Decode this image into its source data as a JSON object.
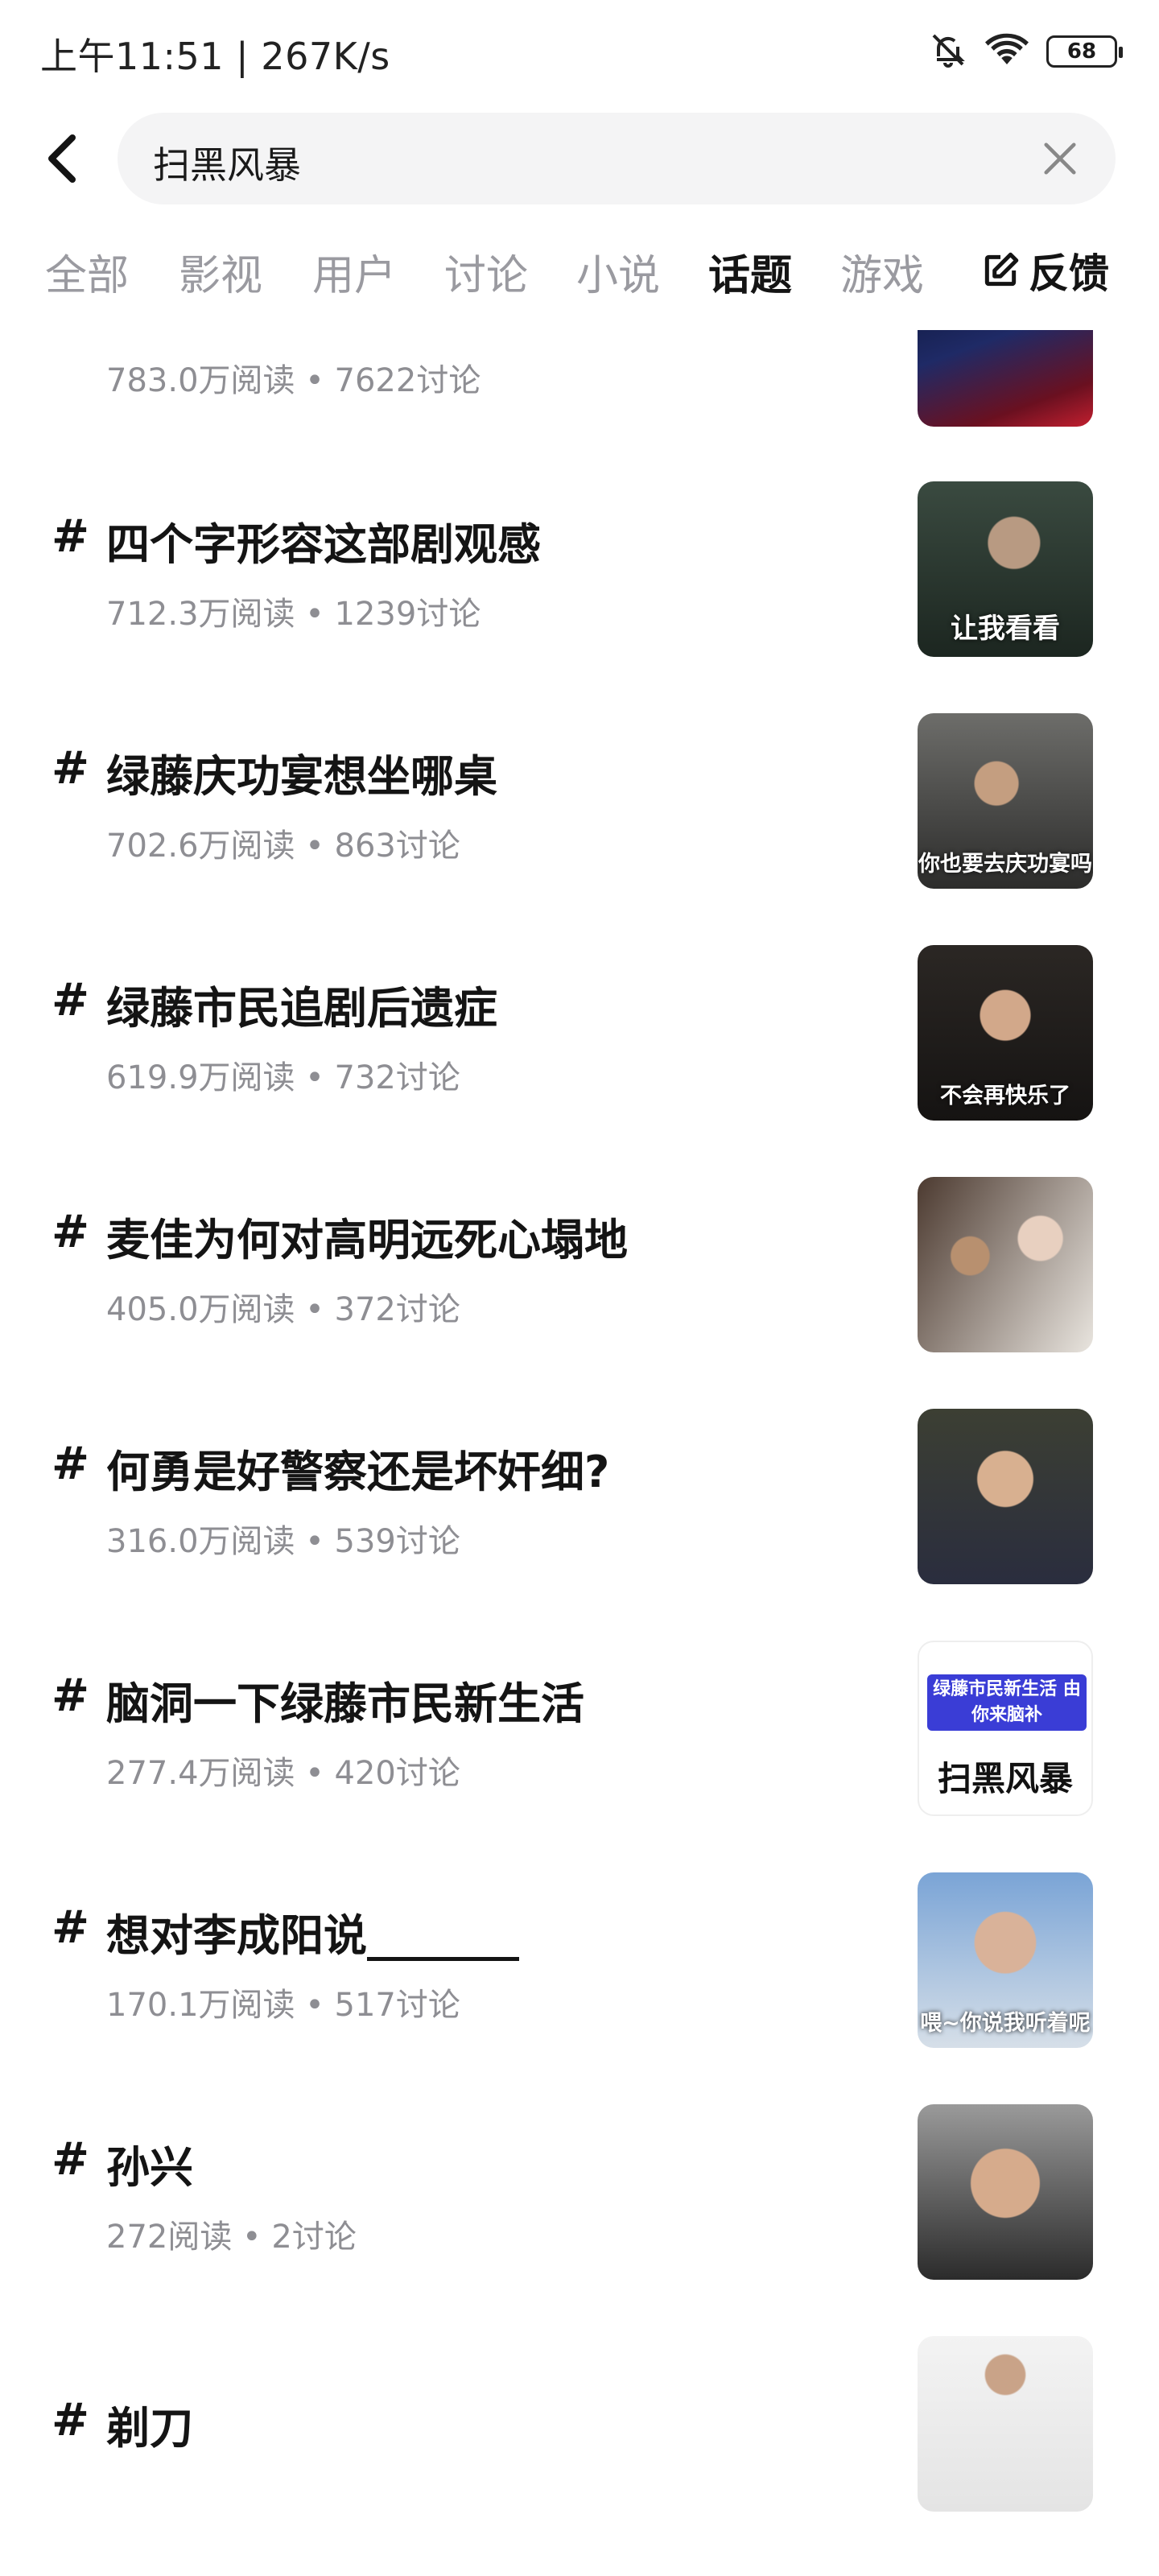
{
  "status_bar": {
    "left_text": "上午11:51 | 267K/s",
    "battery": "68",
    "icons": [
      "mute-bell-icon",
      "wifi-icon",
      "battery-icon"
    ]
  },
  "search": {
    "query": "扫黑风暴",
    "icons": [
      "back-arrow-icon",
      "clear-icon"
    ]
  },
  "tabs": [
    {
      "label": "全部"
    },
    {
      "label": "影视"
    },
    {
      "label": "用户"
    },
    {
      "label": "讨论"
    },
    {
      "label": "小说"
    },
    {
      "label": "话题",
      "active": true
    },
    {
      "label": "游戏"
    }
  ],
  "feedback": {
    "label": "反馈",
    "icon": "edit-icon"
  },
  "partial_topic": {
    "meta": "783.0万阅读 • 7622讨论"
  },
  "topics": [
    {
      "hash": "#",
      "title": "四个字形容这部剧观感",
      "meta": "712.3万阅读 • 1239讨论",
      "thumb_caption": "让我看看"
    },
    {
      "hash": "#",
      "title": "绿藤庆功宴想坐哪桌",
      "meta": "702.6万阅读 • 863讨论",
      "thumb_caption": "你也要去庆功宴吗"
    },
    {
      "hash": "#",
      "title": "绿藤市民追剧后遗症",
      "meta": "619.9万阅读 • 732讨论",
      "thumb_caption": "不会再快乐了"
    },
    {
      "hash": "#",
      "title": "麦佳为何对高明远死心塌地",
      "meta": "405.0万阅读 • 372讨论",
      "thumb_caption": ""
    },
    {
      "hash": "#",
      "title": "何勇是好警察还是坏奸细?",
      "meta": "316.0万阅读 • 539讨论",
      "thumb_caption": ""
    },
    {
      "hash": "#",
      "title": "脑洞一下绿藤市民新生活",
      "meta": "277.4万阅读 • 420讨论",
      "thumb_caption": "",
      "poster_banner": "绿藤市民新生活 由你来脑补",
      "poster_logo": "扫黑风暴"
    },
    {
      "hash": "#",
      "title": "想对李成阳说_______",
      "meta": "170.1万阅读 • 517讨论",
      "thumb_caption": "喂~你说我听着呢"
    },
    {
      "hash": "#",
      "title": "孙兴",
      "meta": "272阅读 • 2讨论",
      "thumb_caption": ""
    },
    {
      "hash": "#",
      "title": "剃刀",
      "meta": "",
      "thumb_caption": ""
    }
  ],
  "colors": {
    "background": "#ffffff",
    "text_primary": "#141414",
    "text_secondary": "#8e8e93",
    "tab_inactive": "#9a9aa0",
    "search_bg": "#f4f4f5"
  }
}
